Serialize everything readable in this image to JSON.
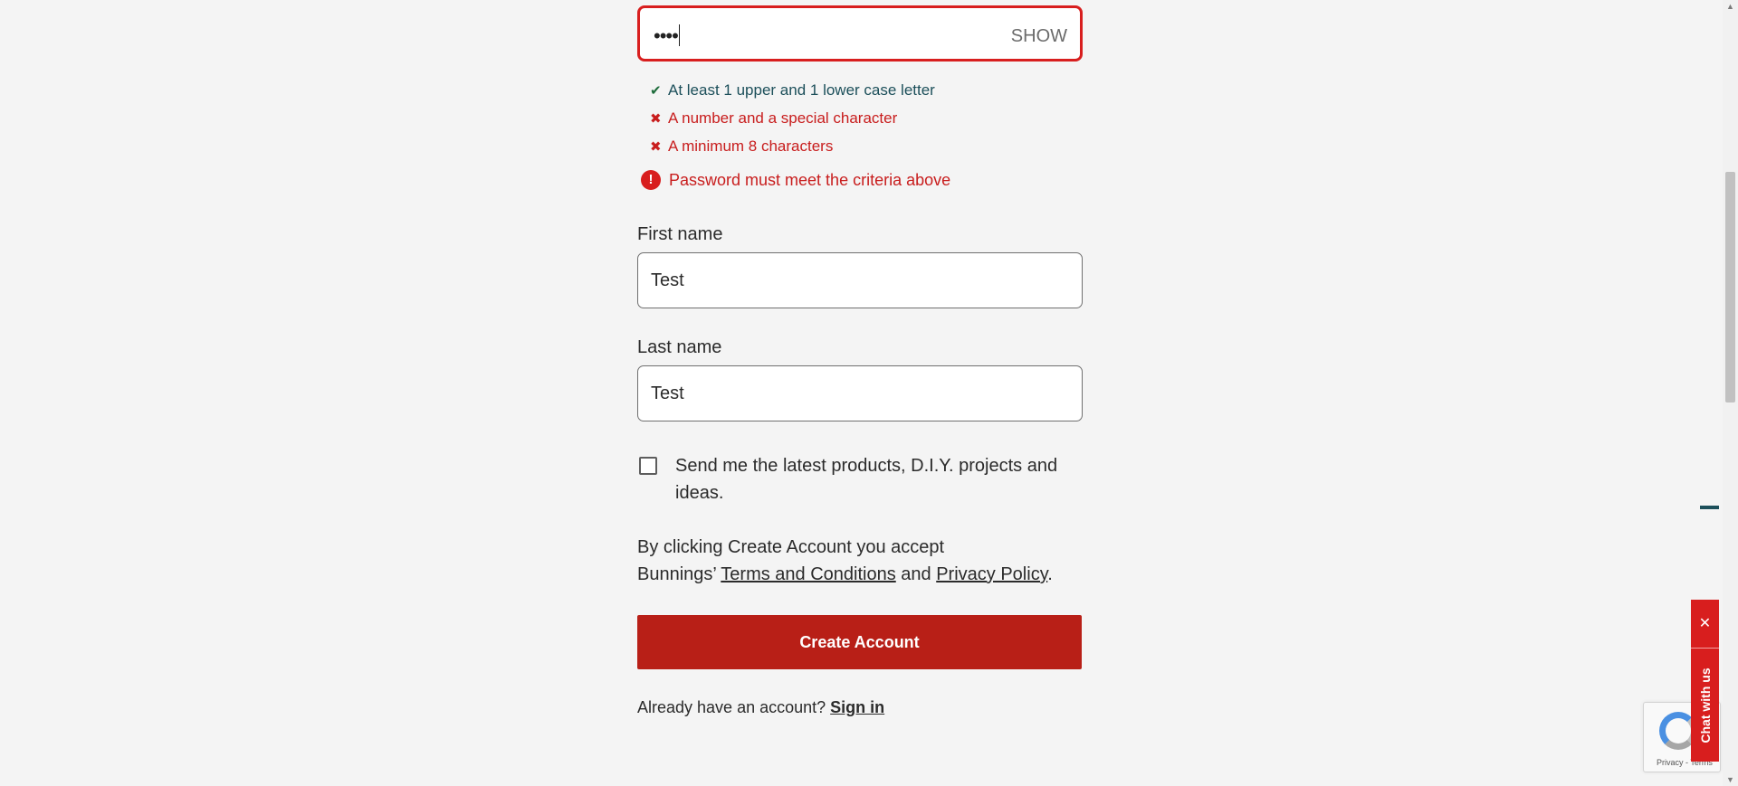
{
  "password": {
    "masked_value": "••••",
    "show_label": "SHOW"
  },
  "criteria": [
    {
      "mark": "✔",
      "status": "pass",
      "text": "At least 1 upper and 1 lower case letter"
    },
    {
      "mark": "✖",
      "status": "fail",
      "text": "A number and a special character"
    },
    {
      "mark": "✖",
      "status": "fail",
      "text": "A minimum 8 characters"
    }
  ],
  "password_error": {
    "icon": "!",
    "text": "Password must meet the criteria above"
  },
  "first_name": {
    "label": "First name",
    "value": "Test"
  },
  "last_name": {
    "label": "Last name",
    "value": "Test"
  },
  "newsletter": {
    "text": "Send me the latest products, D.I.Y. projects and ideas.",
    "checked": false
  },
  "terms": {
    "line1": "By clicking Create Account you accept",
    "prefix": "Bunnings’ ",
    "terms_link": "Terms and Conditions",
    "middle": " and ",
    "privacy_link": "Privacy Policy",
    "suffix": "."
  },
  "create_button": "Create Account",
  "signin": {
    "prompt": "Already have an account? ",
    "link": "Sign in"
  },
  "recaptcha": {
    "links": "Privacy - Terms"
  },
  "chat": {
    "close": "✕",
    "label": "Chat with us"
  },
  "colors": {
    "error": "#d81e1e",
    "button": "#b81f17",
    "pass": "#1c4f5a",
    "background": "#f4f4f4"
  }
}
